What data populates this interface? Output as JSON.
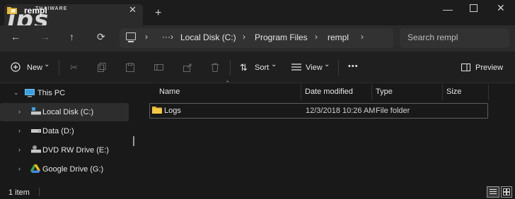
{
  "window": {
    "tab_title": "rempl",
    "tab_close": "✕",
    "new_tab": "+",
    "minimize": "—",
    "close": "✕",
    "watermark_main": "ips",
    "watermark_brand": "THAIWARE"
  },
  "nav": {
    "back": "←",
    "forward": "→",
    "up": "↑",
    "refresh": "⟳",
    "more": "···",
    "breadcrumbs": [
      "Local Disk (C:)",
      "Program Files",
      "rempl"
    ],
    "chevron": "›",
    "search_placeholder": "Search rempl"
  },
  "commands": {
    "new_label": "New",
    "sort_label": "Sort",
    "view_label": "View",
    "more": "•••",
    "preview_label": "Preview",
    "dropdown_caret": "⌄"
  },
  "tree": {
    "this_pc": "This PC",
    "items": [
      "Local Disk (C:)",
      "Data (D:)",
      "DVD RW Drive (E:)",
      "Google Drive (G:)"
    ]
  },
  "columns": {
    "name": "Name",
    "date": "Date modified",
    "type": "Type",
    "size": "Size"
  },
  "files": [
    {
      "name": "Logs",
      "date": "12/3/2018 10:26 AM",
      "type": "File folder",
      "size": ""
    }
  ],
  "status": {
    "count": "1 item"
  },
  "colors": {
    "folder": "#e8b931",
    "accent": "#4cc2ff"
  }
}
